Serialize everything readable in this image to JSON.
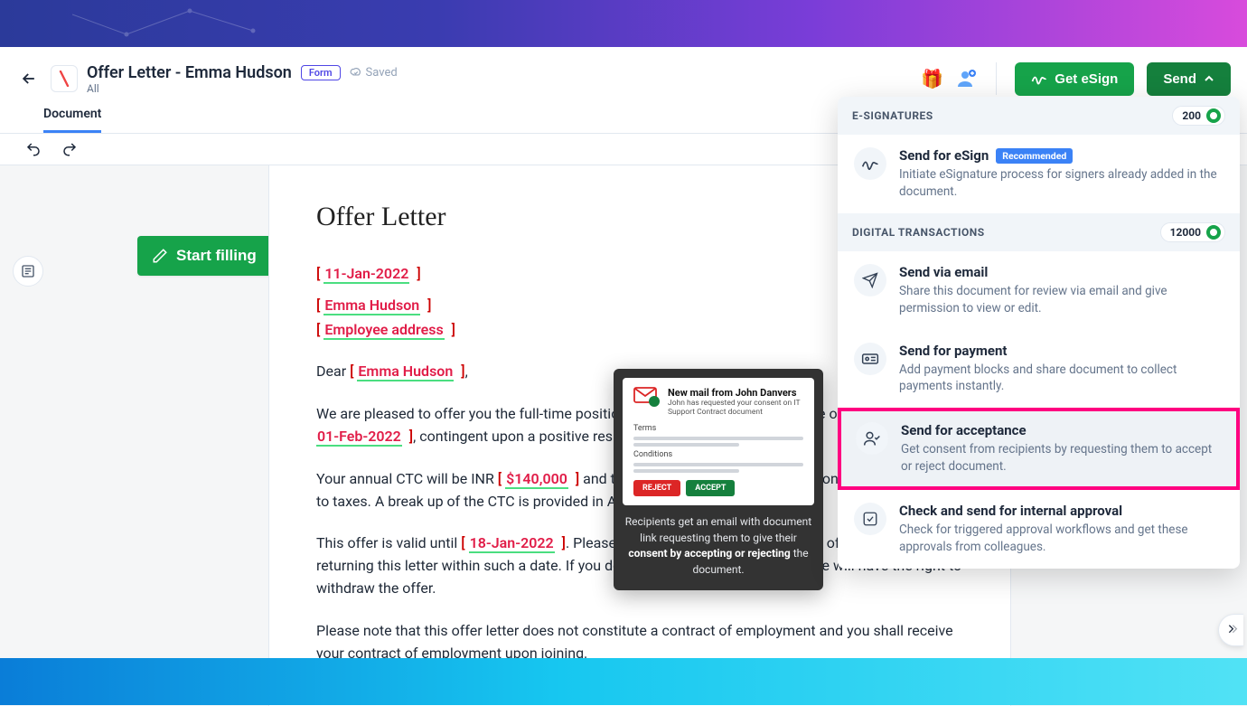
{
  "header": {
    "title": "Offer Letter - Emma Hudson",
    "badge": "Form",
    "saved": "Saved",
    "subtitle": "All"
  },
  "toolbar": {
    "get_esign": "Get eSign",
    "send": "Send"
  },
  "tabs": {
    "document": "Document"
  },
  "actions": {
    "start_filling": "Start filling"
  },
  "letter": {
    "heading": "Offer Letter",
    "date": "11-Jan-2022",
    "name": "Emma Hudson",
    "address_label": "Employee address",
    "greeting_prefix": "Dear ",
    "greeting_name": "Emma Hudson",
    "greeting_suffix": ",",
    "p1_a": "We are pleased to offer you the full-time position at our firm. Your tentative date of joining will be ",
    "joining_date": "01-Feb-2022",
    "p1_b": ", contingent upon a positive result on your background check.",
    "p2_a": "Your annual CTC will be INR ",
    "ctc": "$140,000",
    "p2_b": " and the payment will be made on a monthly basis, subject to taxes. A break up of the CTC is provided in Appendix A.",
    "p3_a": "This offer is valid until ",
    "valid_until": "18-Jan-2022",
    "p3_b": ". Please confirm your acceptance of this offer by signing and returning this letter within such a date. If you do not accept this offer by then, we will have the right to withdraw the offer.",
    "p4": "Please note that this offer letter does not constitute a contract of employment and you shall receive your contract of employment upon joining."
  },
  "tooltip": {
    "mail_title": "New mail from John Danvers",
    "mail_sub": "John has requested your consent on IT Support Contract document",
    "terms": "Terms",
    "conditions": "Conditions",
    "reject": "REJECT",
    "accept": "ACCEPT",
    "caption_1": "Recipients get an email with document link requesting them to give their ",
    "caption_bold": "consent by accepting or rejecting",
    "caption_2": " the document."
  },
  "dropdown": {
    "esig_header": "E-SIGNATURES",
    "esig_count": "200",
    "trans_header": "DIGITAL TRANSACTIONS",
    "trans_count": "12000",
    "items": {
      "esign": {
        "title": "Send for eSign",
        "badge": "Recommended",
        "desc": "Initiate eSignature process for signers already added in the document."
      },
      "email": {
        "title": "Send via email",
        "desc": "Share this document for review via email and give permission to view or edit."
      },
      "payment": {
        "title": "Send for payment",
        "desc": "Add payment blocks and share document to collect payments instantly."
      },
      "acceptance": {
        "title": "Send for acceptance",
        "desc": "Get consent from recipients by requesting them to accept or reject document."
      },
      "approval": {
        "title": "Check and send for internal approval",
        "desc": "Check for triggered approval workflows and get these approvals from colleagues."
      }
    }
  }
}
